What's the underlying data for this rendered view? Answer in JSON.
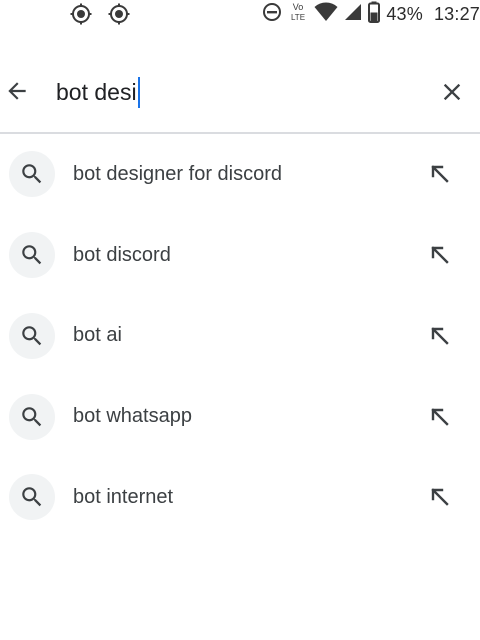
{
  "status_bar": {
    "left_icons": [
      "location-target-icon",
      "location-target-icon"
    ],
    "right_icons": [
      "do-not-disturb-icon",
      "volte-icon",
      "wifi-icon",
      "cell-signal-icon",
      "battery-icon"
    ],
    "volte_top": "Vo",
    "volte_bottom": "LTE",
    "battery_percent": "43%",
    "time": "13:27"
  },
  "search": {
    "back_icon": "arrow-back-icon",
    "query": "bot desi",
    "clear_icon": "close-icon",
    "caret_color": "#1a73e8"
  },
  "suggestions": [
    {
      "label": "bot designer for discord",
      "icon": "search-icon",
      "action_icon": "arrow-up-left-icon"
    },
    {
      "label": "bot discord",
      "icon": "search-icon",
      "action_icon": "arrow-up-left-icon"
    },
    {
      "label": "bot ai",
      "icon": "search-icon",
      "action_icon": "arrow-up-left-icon"
    },
    {
      "label": "bot whatsapp",
      "icon": "search-icon",
      "action_icon": "arrow-up-left-icon"
    },
    {
      "label": "bot internet",
      "icon": "search-icon",
      "action_icon": "arrow-up-left-icon"
    }
  ],
  "colors": {
    "text_primary": "#202124",
    "suggestion_text": "#3c4043",
    "icon_circle_bg": "#f1f3f4",
    "divider": "#dadce0"
  }
}
